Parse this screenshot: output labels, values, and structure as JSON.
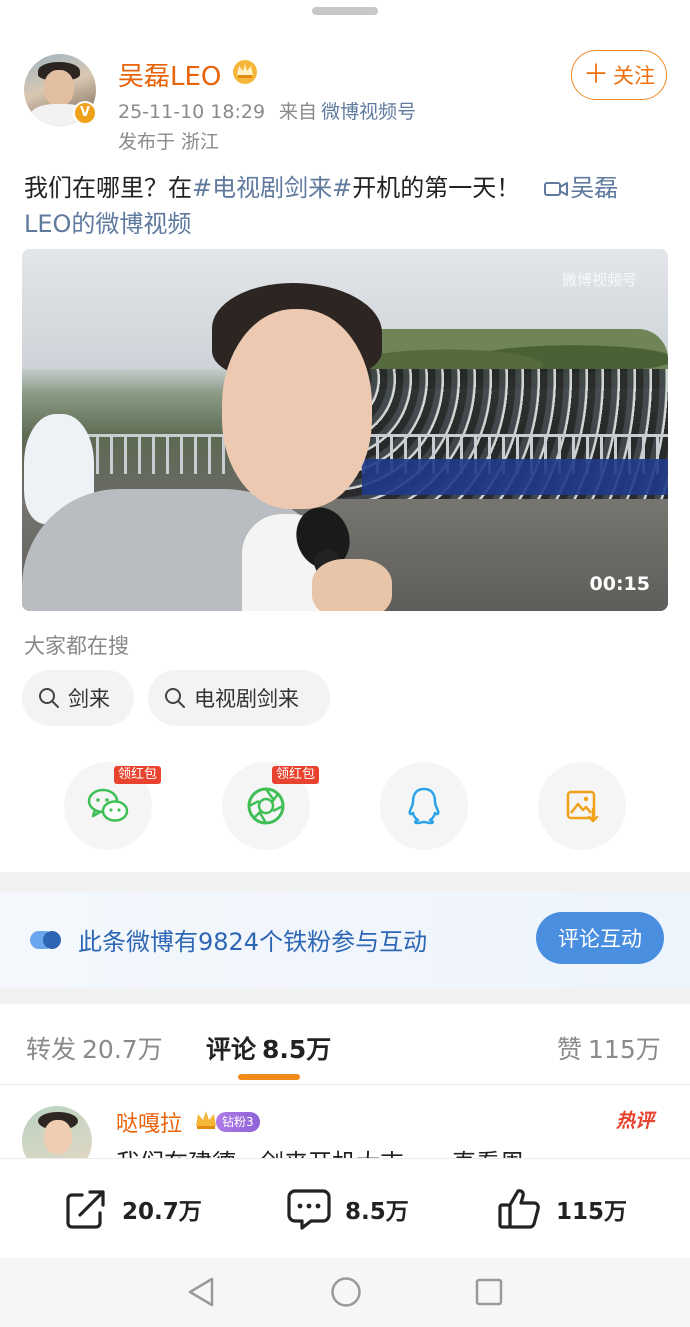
{
  "author": {
    "name": "吴磊LEO",
    "verified_badge": "V",
    "timestamp": "25-11-10 18:29",
    "via_label": "来自",
    "source": "微博视频号",
    "location": "发布于 浙江",
    "follow_label": "关注"
  },
  "post": {
    "text_prefix": "我们在哪里？在",
    "hashtag": "#电视剧剑来#",
    "text_suffix": "开机的第一天！",
    "video_link": "吴磊LEO的微博视频"
  },
  "video": {
    "watermark": "微博视频号",
    "duration": "00:15"
  },
  "search": {
    "title": "大家都在搜",
    "chips": [
      "剑来",
      "电视剧剑来"
    ]
  },
  "share": {
    "items": [
      {
        "icon": "wechat-icon",
        "badge": "领红包",
        "color": "#3fbf55"
      },
      {
        "icon": "moments-icon",
        "badge": "领红包",
        "color": "#3fbf55"
      },
      {
        "icon": "qq-icon",
        "color": "#2aa3e8"
      },
      {
        "icon": "save-image-icon",
        "color": "#f0a11a"
      }
    ]
  },
  "fan_interaction": {
    "text": "此条微博有9824个铁粉参与互动",
    "button": "评论互动"
  },
  "tabs": [
    {
      "label": "转发",
      "count": "20.7万"
    },
    {
      "label": "评论",
      "count": "8.5万"
    },
    {
      "label": "赞",
      "count": "115万"
    }
  ],
  "comment": {
    "name": "哒嘎拉",
    "fan_badge": "钻粉3",
    "hot_label": "热评",
    "text": "我们在建德，剑来开机大吉，一直看周"
  },
  "actions": {
    "repost_count": "20.7万",
    "comment_count": "8.5万",
    "like_count": "115万"
  },
  "colors": {
    "accent_orange": "#e8630a",
    "link_blue": "#5f7a9e",
    "button_blue": "#4a8ee0",
    "tab_underline": "#f08b1a"
  }
}
